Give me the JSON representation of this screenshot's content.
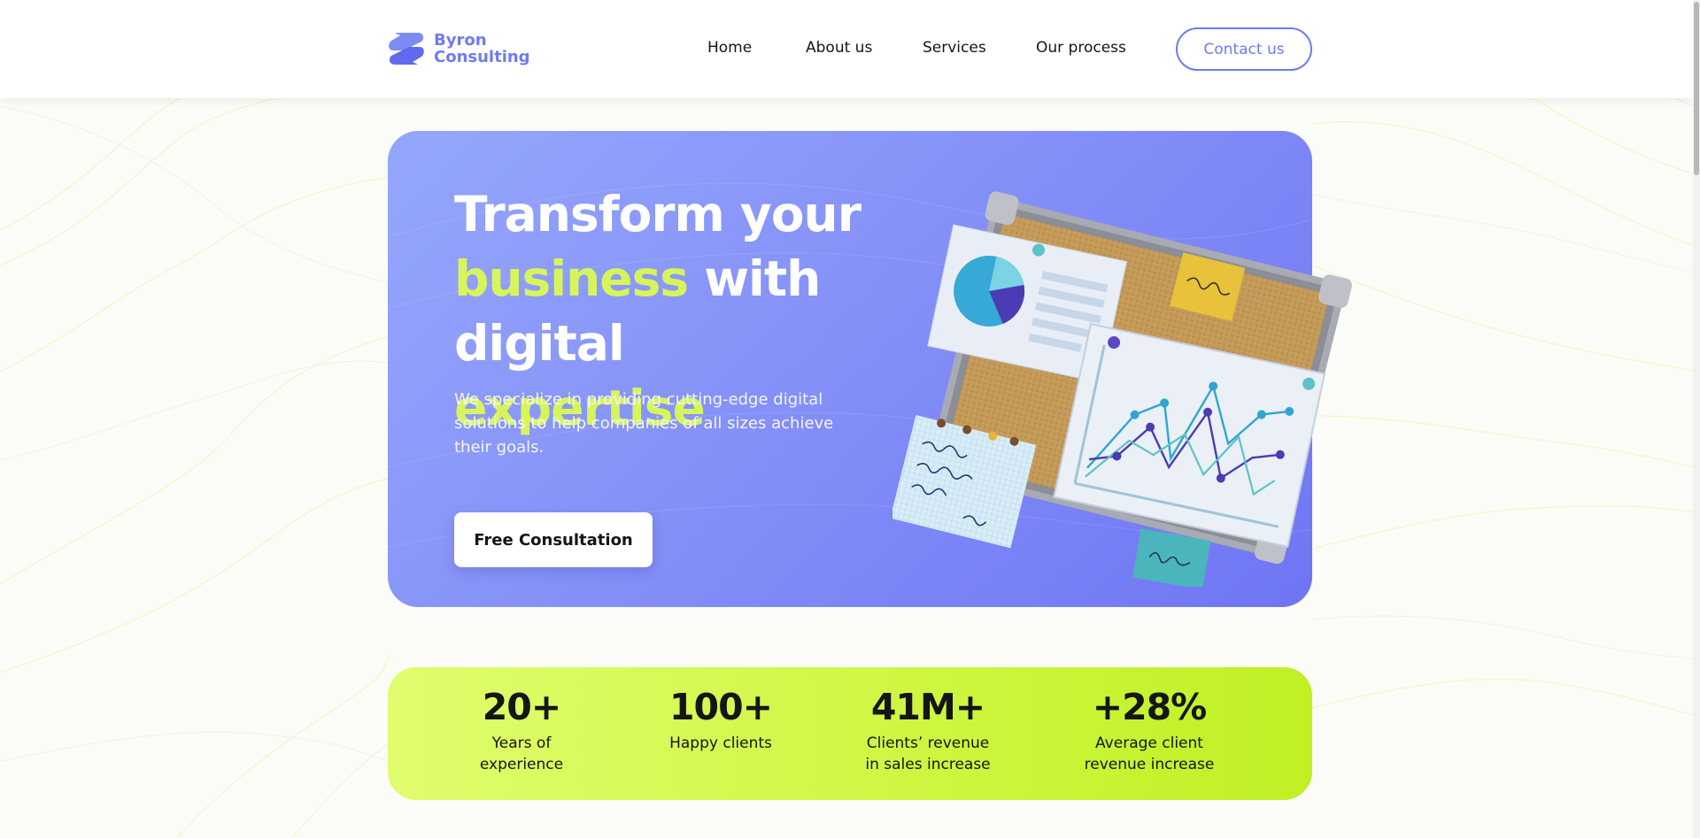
{
  "brand": {
    "line1": "Byron",
    "line2": "Consulting",
    "color": "#6e7bf2"
  },
  "nav": {
    "items": [
      {
        "label": "Home"
      },
      {
        "label": "About us"
      },
      {
        "label": "Services"
      },
      {
        "label": "Our process"
      }
    ],
    "contact_label": "Contact us"
  },
  "hero": {
    "title_line1": "Transform your",
    "title_line2_lime": "business",
    "title_line2_white": " with",
    "title_line3_white": "digital ",
    "title_line3_lime": "expertise",
    "subtitle": "We specialize in providing cutting-edge digital solutions to help companies of all sizes achieve their goals.",
    "cta_label": "Free Consultation"
  },
  "stats": [
    {
      "value": "20+",
      "label_line1": "Years of",
      "label_line2": "experience"
    },
    {
      "value": "100+",
      "label_line1": "Happy clients",
      "label_line2": ""
    },
    {
      "value": "41M+",
      "label_line1": "Clients’ revenue",
      "label_line2": "in sales increase"
    },
    {
      "value": "+28%",
      "label_line1": "Average client",
      "label_line2": "revenue increase"
    }
  ],
  "colors": {
    "accent": "#6e7bf2",
    "lime": "#d7f55b",
    "hero_gradient": [
      "#95a7fb",
      "#6f75f3"
    ],
    "stats_gradient": [
      "#e0fd6e",
      "#bff024"
    ]
  },
  "icons": [
    "logo-mark-icon",
    "corkboard-illustration"
  ]
}
